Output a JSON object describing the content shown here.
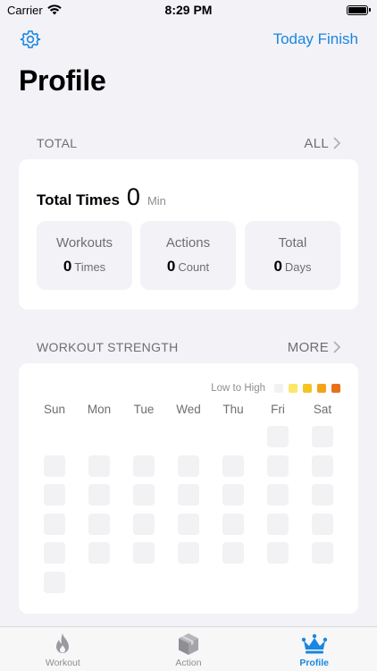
{
  "status": {
    "carrier": "Carrier",
    "time": "8:29 PM"
  },
  "nav": {
    "right_action": "Today Finish"
  },
  "page": {
    "title": "Profile"
  },
  "total_section": {
    "header": "TOTAL",
    "link": "ALL",
    "total_times_label": "Total Times",
    "total_times_value": "0",
    "total_times_unit": "Min",
    "stats": [
      {
        "title": "Workouts",
        "value": "0",
        "unit": "Times"
      },
      {
        "title": "Actions",
        "value": "0",
        "unit": "Count"
      },
      {
        "title": "Total",
        "value": "0",
        "unit": "Days"
      }
    ]
  },
  "strength_section": {
    "header": "WORKOUT STRENGTH",
    "link": "MORE",
    "legend_label": "Low to High",
    "legend_colors": [
      "#f2f2f4",
      "#fbe76a",
      "#f6c320",
      "#f3a31a",
      "#e8701a"
    ],
    "weekdays": [
      "Sun",
      "Mon",
      "Tue",
      "Wed",
      "Thu",
      "Fri",
      "Sat"
    ]
  },
  "tabs": [
    {
      "label": "Workout",
      "icon": "flame-icon",
      "active": false
    },
    {
      "label": "Action",
      "icon": "box-icon",
      "active": false
    },
    {
      "label": "Profile",
      "icon": "crown-icon",
      "active": true
    }
  ],
  "colors": {
    "accent": "#1a86e0",
    "background": "#f2f2f7"
  }
}
